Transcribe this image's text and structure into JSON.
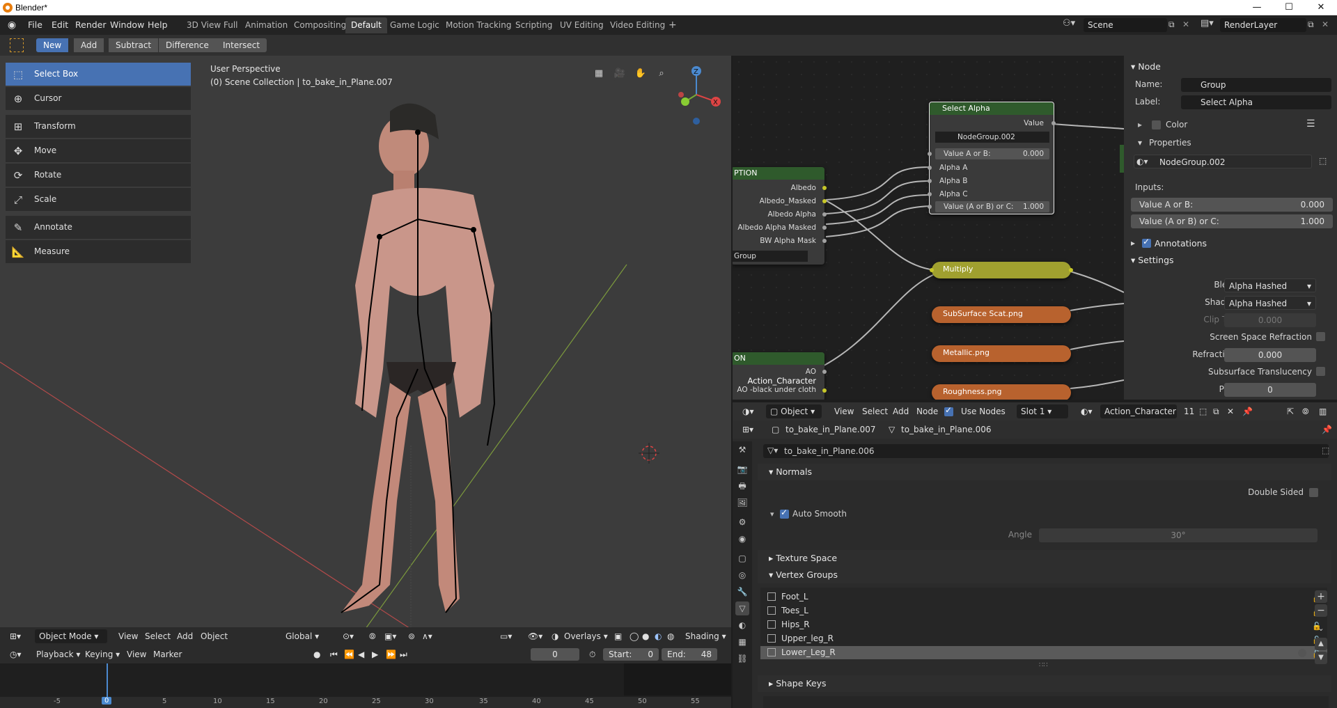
{
  "window": {
    "title": "Blender*",
    "minimize": "—",
    "maximize": "☐",
    "close": "✕"
  },
  "menu": [
    "File",
    "Edit",
    "Render",
    "Window",
    "Help"
  ],
  "workspaces": [
    "3D View Full",
    "Animation",
    "Compositing",
    "Default",
    "Game Logic",
    "Motion Tracking",
    "Scripting",
    "UV Editing",
    "Video Editing",
    "+"
  ],
  "active_workspace": "Default",
  "scene": {
    "name": "Scene",
    "render_layer": "RenderLayer"
  },
  "tool_header": {
    "modes": [
      "New",
      "Add",
      "Subtract",
      "Difference",
      "Intersect"
    ],
    "active": "New"
  },
  "tools": [
    "Select Box",
    "Cursor",
    "Transform",
    "Move",
    "Rotate",
    "Scale",
    "Annotate",
    "Measure"
  ],
  "viewport": {
    "perspective": "User Perspective",
    "collection": "(0) Scene Collection | to_bake_in_Plane.007",
    "header": {
      "mode": "Object Mode",
      "menus": [
        "View",
        "Select",
        "Add",
        "Object"
      ],
      "orientation": "Global",
      "overlays": "Overlays",
      "shading": "Shading"
    },
    "gizmo": {
      "z": "Z",
      "x": "X"
    }
  },
  "timeline": {
    "menus": [
      "Playback",
      "Keying",
      "View",
      "Marker"
    ],
    "current_frame": "0",
    "start_label": "Start:",
    "start": "0",
    "end_label": "End:",
    "end": "48",
    "ruler": [
      "-5",
      "0",
      "5",
      "10",
      "15",
      "20",
      "25",
      "30",
      "35",
      "40",
      "45",
      "50",
      "55"
    ]
  },
  "nodes": {
    "left_node_title": "PTION",
    "left_outputs": [
      "Albedo",
      "Albedo_Masked",
      "Albedo Alpha",
      "Albedo Alpha  Masked",
      "BW  Alpha Mask"
    ],
    "left_group": "Group",
    "ao_title": "ON",
    "ao_label1": "AO",
    "ao_label2": "Action_Character",
    "ao_label3": "AO -black under cloth",
    "select_alpha": {
      "title": "Select Alpha",
      "output": "Value",
      "group": "NodeGroup.002",
      "input1": "Value A or B:",
      "input1_val": "0.000",
      "alpha_a": "Alpha A",
      "alpha_b": "Alpha B",
      "alpha_c": "Alpha C",
      "input2": "Value (A or B) or C:",
      "input2_val": "1.000"
    },
    "multiply": "Multiply",
    "textures": [
      "SubSurface Scat.png",
      "Metallic.png",
      "Roughness.png"
    ]
  },
  "node_sidebar": {
    "section": "Node",
    "name_label": "Name:",
    "name": "Group",
    "label_label": "Label:",
    "label": "Select Alpha",
    "color": "Color",
    "properties": "Properties",
    "group": "NodeGroup.002",
    "inputs": "Inputs:",
    "in1_label": "Value A or B:",
    "in1_val": "0.000",
    "in2_label": "Value (A or B) or C:",
    "in2_val": "1.000",
    "annotations": "Annotations",
    "settings": "Settings",
    "blend_mode_label": "Blend Mode",
    "blend_mode": "Alpha Hashed",
    "shadow_mode_label": "Shadow Mode",
    "shadow_mode": "Alpha Hashed",
    "clip_label": "Clip Threshold",
    "clip": "0.000",
    "ssr": "Screen Space Refraction",
    "refraction_label": "Refraction Depth",
    "refraction": "0.000",
    "subsurface": "Subsurface Translucency",
    "pass_label": "Pass Index",
    "pass": "0"
  },
  "node_header": {
    "type": "Object",
    "menus": [
      "View",
      "Select",
      "Add",
      "Node"
    ],
    "use_nodes": "Use Nodes",
    "slot": "Slot 1",
    "material": "Action_Character",
    "users": "11"
  },
  "properties": {
    "breadcrumb1": "to_bake_in_Plane.007",
    "breadcrumb2": "to_bake_in_Plane.006",
    "mesh_name": "to_bake_in_Plane.006",
    "normals": "Normals",
    "double_sided": "Double Sided",
    "auto_smooth": "Auto Smooth",
    "angle_label": "Angle",
    "angle": "30°",
    "texture_space": "Texture Space",
    "vertex_groups": "Vertex Groups",
    "groups": [
      "Foot_L",
      "Toes_L",
      "Hips_R",
      "Upper_leg_R",
      "Lower_Leg_R"
    ],
    "selected_group": "Lower_Leg_R",
    "shape_keys": "Shape Keys"
  }
}
